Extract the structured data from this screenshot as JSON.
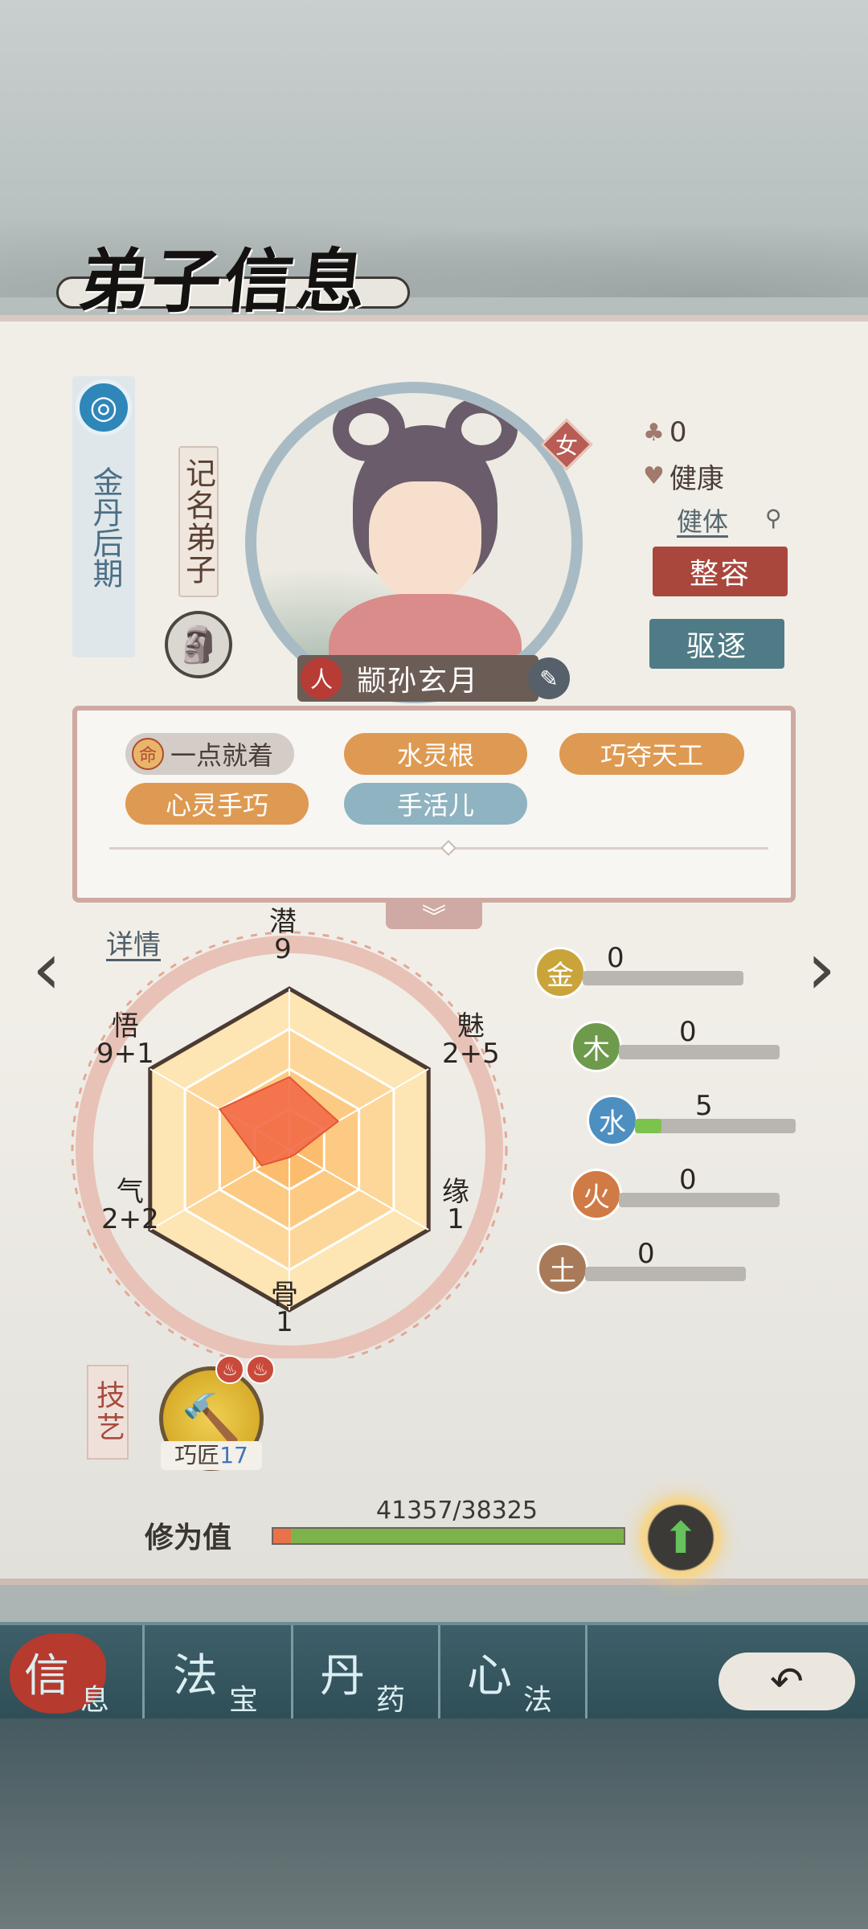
{
  "header": {
    "title": "弟子信息"
  },
  "disciple": {
    "realm": "金丹后期",
    "title": "记名弟子",
    "gender": "女",
    "race": "人",
    "name": "颛孙玄月",
    "luck_value": "0",
    "health": "健康",
    "physique": "健体"
  },
  "actions": {
    "makeover": "整容",
    "expel": "驱逐"
  },
  "traits": [
    {
      "label": "一点就着",
      "style": "gray",
      "fate_icon": "命"
    },
    {
      "label": "水灵根",
      "style": "orange"
    },
    {
      "label": "巧夺天工",
      "style": "orange"
    },
    {
      "label": "心灵手巧",
      "style": "orange"
    },
    {
      "label": "手活儿",
      "style": "blue"
    }
  ],
  "details_link": "详情",
  "attributes": {
    "qian": {
      "name": "潜",
      "value": "9"
    },
    "mei": {
      "name": "魅",
      "value": "2+5"
    },
    "yuan": {
      "name": "缘",
      "value": "1"
    },
    "gu": {
      "name": "骨",
      "value": "1"
    },
    "qi": {
      "name": "气",
      "value": "2+2"
    },
    "wu": {
      "name": "悟",
      "value": "9+1"
    }
  },
  "radar_max": 20,
  "radar_values": {
    "qian": 9,
    "mei": 7,
    "yuan": 1,
    "gu": 1,
    "qi": 4,
    "wu": 10
  },
  "elements": [
    {
      "name": "金",
      "value": "0",
      "color": "#c9a43b"
    },
    {
      "name": "木",
      "value": "0",
      "color": "#6e9a4c"
    },
    {
      "name": "水",
      "value": "5",
      "color": "#4e8fc1"
    },
    {
      "name": "火",
      "value": "0",
      "color": "#d07a45"
    },
    {
      "name": "土",
      "value": "0",
      "color": "#a87a58"
    }
  ],
  "element_max": 30,
  "skills": {
    "section_label": "技艺",
    "skill_name": "巧匠",
    "skill_level": "17"
  },
  "cultivation": {
    "label": "修为值",
    "value_text": "41357/38325",
    "current": 41357,
    "max": 38325
  },
  "tabs": [
    {
      "main": "信",
      "sub": "息",
      "active": true
    },
    {
      "main": "法",
      "sub": "宝",
      "active": false
    },
    {
      "main": "丹",
      "sub": "药",
      "active": false
    },
    {
      "main": "心",
      "sub": "法",
      "active": false
    }
  ]
}
